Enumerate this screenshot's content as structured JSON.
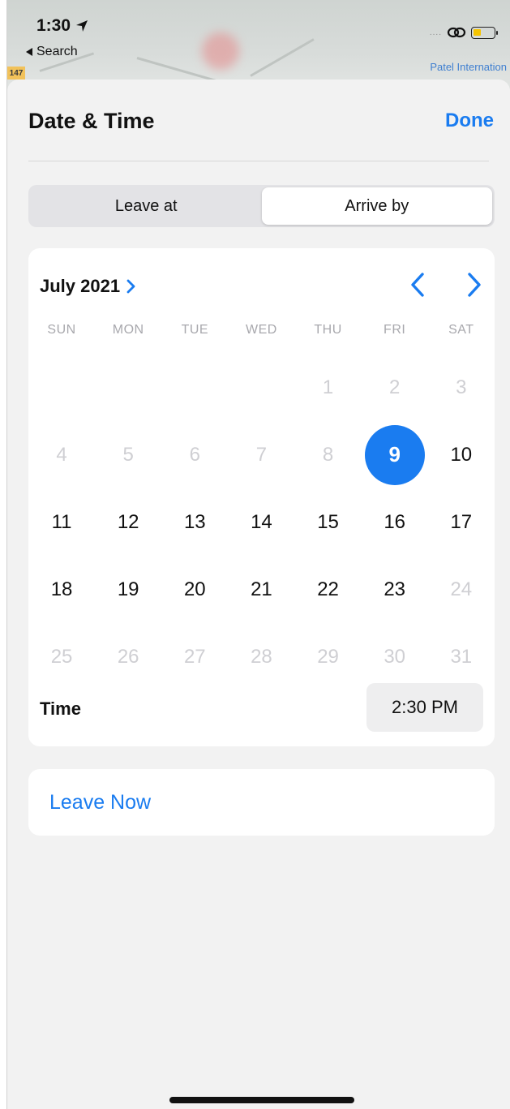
{
  "status_bar": {
    "time": "1:30",
    "back_label": "Search",
    "signal_dots": "....",
    "location_icon": "location-arrow-icon",
    "link_icon": "link-icon",
    "battery_color": "#f5c400"
  },
  "map": {
    "road_badge": "147",
    "place_label": "Patel Internation"
  },
  "sheet": {
    "title": "Date & Time",
    "done_label": "Done"
  },
  "segmented": {
    "options": [
      "Leave at",
      "Arrive by"
    ],
    "selected": "Arrive by"
  },
  "calendar": {
    "month_label": "July 2021",
    "weekdays": [
      "SUN",
      "MON",
      "TUE",
      "WED",
      "THU",
      "FRI",
      "SAT"
    ],
    "weeks": [
      [
        null,
        null,
        null,
        null,
        "1",
        "2",
        "3"
      ],
      [
        "4",
        "5",
        "6",
        "7",
        "8",
        "9",
        "10"
      ],
      [
        "11",
        "12",
        "13",
        "14",
        "15",
        "16",
        "17"
      ],
      [
        "18",
        "19",
        "20",
        "21",
        "22",
        "23",
        "24"
      ],
      [
        "25",
        "26",
        "27",
        "28",
        "29",
        "30",
        "31"
      ]
    ],
    "selected_day": "9",
    "available_days": [
      "9",
      "10",
      "11",
      "12",
      "13",
      "14",
      "15",
      "16",
      "17",
      "18",
      "19",
      "20",
      "21",
      "22",
      "23"
    ],
    "prev_icon": "chevron-left-icon",
    "next_icon": "chevron-right-icon"
  },
  "time": {
    "label": "Time",
    "value": "2:30 PM"
  },
  "leave_now": {
    "label": "Leave Now"
  },
  "colors": {
    "accent": "#1a7cf0",
    "disabled_text": "#cfcfd3",
    "sheet_bg": "#f2f2f2"
  }
}
